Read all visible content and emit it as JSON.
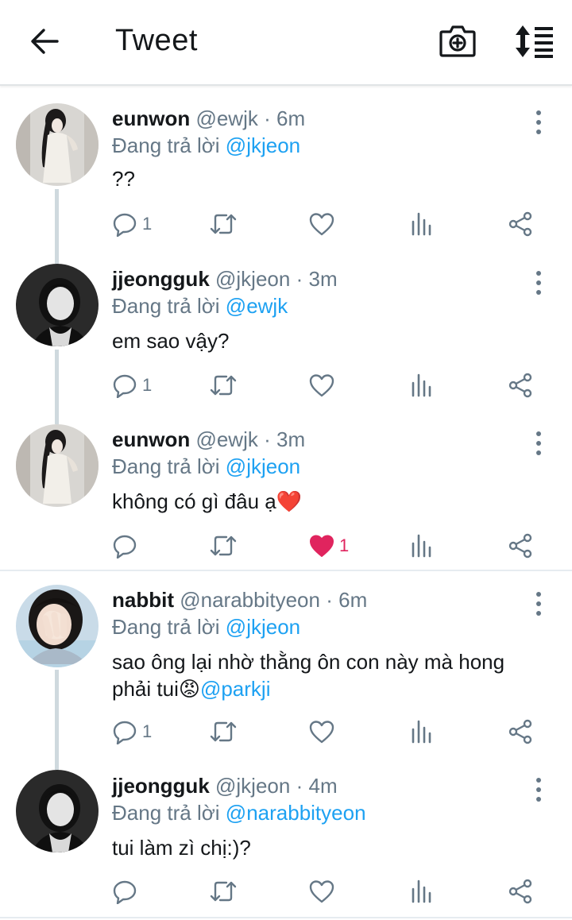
{
  "header": {
    "title": "Tweet"
  },
  "reply_prefix": "Đang trả lời",
  "tweets": [
    {
      "name": "eunwon",
      "handle": "@ewjk",
      "time": "6m",
      "reply_to": "@jkjeon",
      "text": "??",
      "reply_count": "1",
      "like_count": "",
      "liked": false
    },
    {
      "name": "jjeongguk",
      "handle": "@jkjeon",
      "time": "3m",
      "reply_to": "@ewjk",
      "text": "em sao vậy?",
      "reply_count": "1",
      "like_count": "",
      "liked": false
    },
    {
      "name": "eunwon",
      "handle": "@ewjk",
      "time": "3m",
      "reply_to": "@jkjeon",
      "text": "không có gì đâu ạ❤️",
      "reply_count": "",
      "like_count": "1",
      "liked": true
    },
    {
      "name": "nabbit",
      "handle": "@narabbityeon",
      "time": "6m",
      "reply_to": "@jkjeon",
      "text_line1": "sao ông lại nhờ thằng ôn con này mà hong",
      "text_line2": "phải tui😡",
      "mention_in_text": "@parkji",
      "reply_count": "1",
      "like_count": "",
      "liked": false
    },
    {
      "name": "jjeongguk",
      "handle": "@jkjeon",
      "time": "4m",
      "reply_to": "@narabbityeon",
      "text": "tui làm zì chị:)?",
      "reply_count": "",
      "like_count": "",
      "liked": false
    }
  ],
  "separator_dot": "·",
  "colors": {
    "accent": "#1da1f2",
    "secondary_text": "#657786",
    "like": "#e0245e",
    "thread_line": "#cfd9de"
  },
  "icons": [
    "back-arrow-icon",
    "camera-plus-icon",
    "sort-icon",
    "more-vertical-icon",
    "reply-icon",
    "retweet-icon",
    "like-icon",
    "analytics-icon",
    "share-icon"
  ]
}
